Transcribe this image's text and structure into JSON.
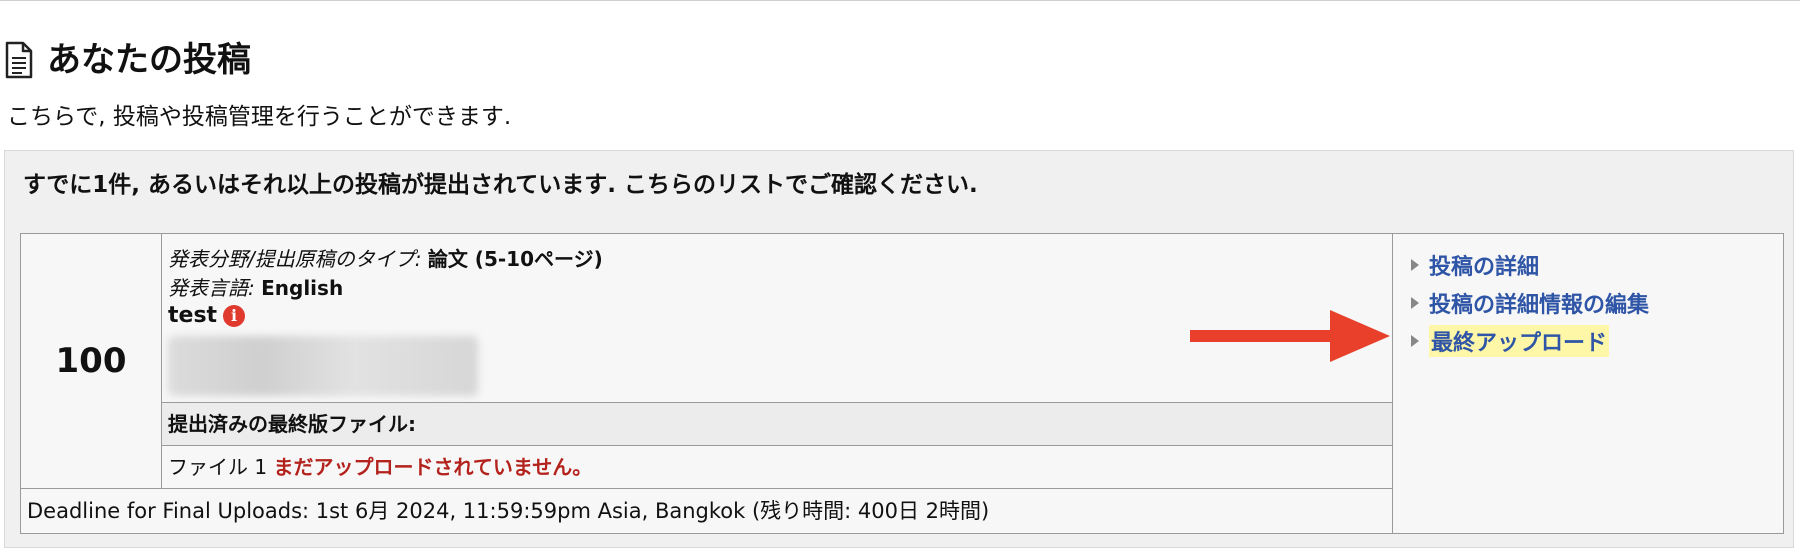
{
  "page": {
    "title": "あなたの投稿",
    "intro": "こちらで, 投稿や投稿管理を行うことができます."
  },
  "panel": {
    "heading": "すでに1件, あるいはそれ以上の投稿が提出されています. こちらのリストでご確認ください."
  },
  "submission": {
    "number": "100",
    "type_label": "発表分野/提出原稿のタイプ:",
    "type_value": "論文 (5-10ページ)",
    "language_label": "発表言語:",
    "language_value": "English",
    "title": "test",
    "final_files_heading": "提出済みの最終版ファイル:",
    "file_label": "ファイル 1",
    "file_status": "まだアップロードされていません。",
    "deadline": "Deadline for Final Uploads: 1st 6月 2024, 11:59:59pm Asia, Bangkok (残り時間: 400日 2時間)"
  },
  "actions": [
    {
      "label": "投稿の詳細",
      "highlight": false
    },
    {
      "label": "投稿の詳細情報の編集",
      "highlight": false
    },
    {
      "label": "最終アップロード",
      "highlight": true
    }
  ],
  "icons": {
    "page": "document-icon",
    "info": "info-icon",
    "bullet": "triangle-bullet-icon",
    "annotation": "red-arrow-icon"
  },
  "colors": {
    "link": "#2f55a6",
    "warning": "#b3221c",
    "highlight": "#fff7a8",
    "arrow": "#e8402b"
  }
}
